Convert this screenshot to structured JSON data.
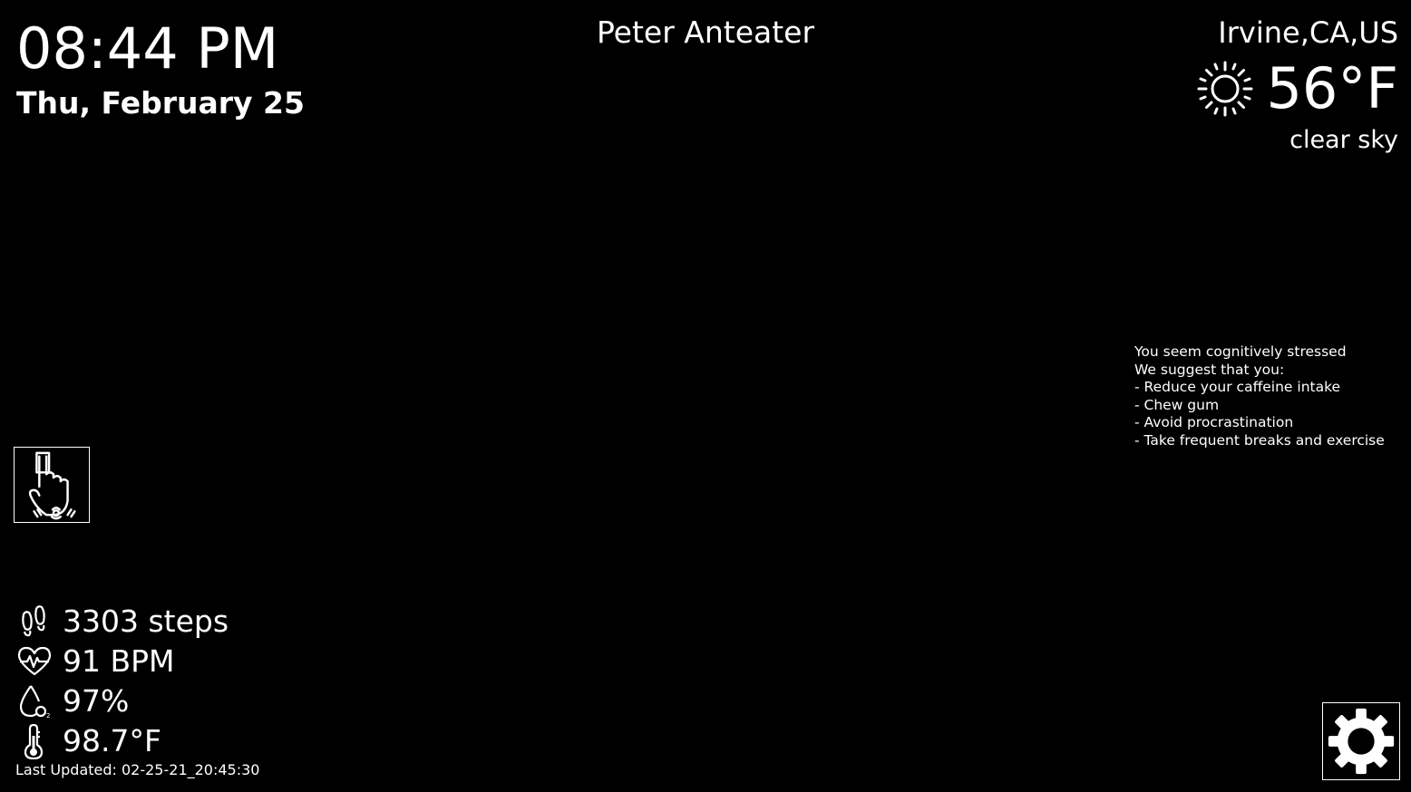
{
  "clock": {
    "time": "08:44 PM",
    "date": "Thu, February 25"
  },
  "user": {
    "name": "Peter Anteater"
  },
  "weather": {
    "location": "Irvine,CA,US",
    "temperature": "56°F",
    "description": "clear sky",
    "icon": "sun-icon"
  },
  "suggestions": {
    "lines": [
      "You seem cognitively stressed",
      "We suggest that you:",
      "- Reduce your caffeine intake",
      "- Chew gum",
      "- Avoid procrastination",
      "- Take frequent breaks and exercise"
    ]
  },
  "touch_button": {
    "icon": "fingerprint-touch-icon"
  },
  "vitals": {
    "steps": {
      "value": "3303 steps",
      "icon": "footsteps-icon"
    },
    "heart_rate": {
      "value": "91 BPM",
      "icon": "heart-pulse-icon"
    },
    "oxygen": {
      "value": "97%",
      "icon": "oxygen-drop-icon"
    },
    "body_temp": {
      "value": "98.7°F",
      "icon": "thermometer-icon"
    },
    "last_updated": "Last Updated: 02-25-21_20:45:30"
  },
  "settings_button": {
    "icon": "gear-icon"
  },
  "colors": {
    "background": "#000000",
    "foreground": "#ffffff"
  }
}
